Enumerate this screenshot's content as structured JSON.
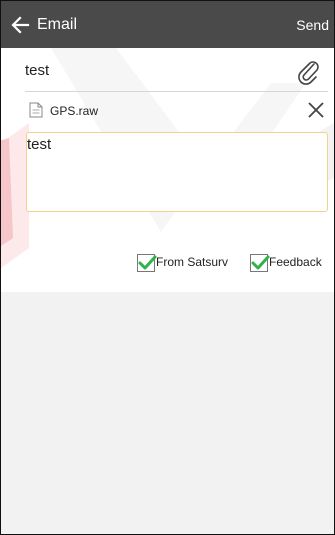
{
  "appbar": {
    "title": "Email",
    "send_label": "Send",
    "back_icon": "arrow-left-icon"
  },
  "form": {
    "subject": "test",
    "attach_icon": "paperclip-icon",
    "attachment": {
      "filename": "GPS.raw",
      "file_icon": "document-icon",
      "remove_icon": "close-icon"
    },
    "body": "test",
    "checkboxes": [
      {
        "label": "From Satsurv",
        "checked": true
      },
      {
        "label": "Feedback",
        "checked": true
      }
    ]
  },
  "colors": {
    "appbar_bg": "#4a4a4a",
    "check_green": "#2db34a",
    "body_border": "#f0d28a"
  }
}
